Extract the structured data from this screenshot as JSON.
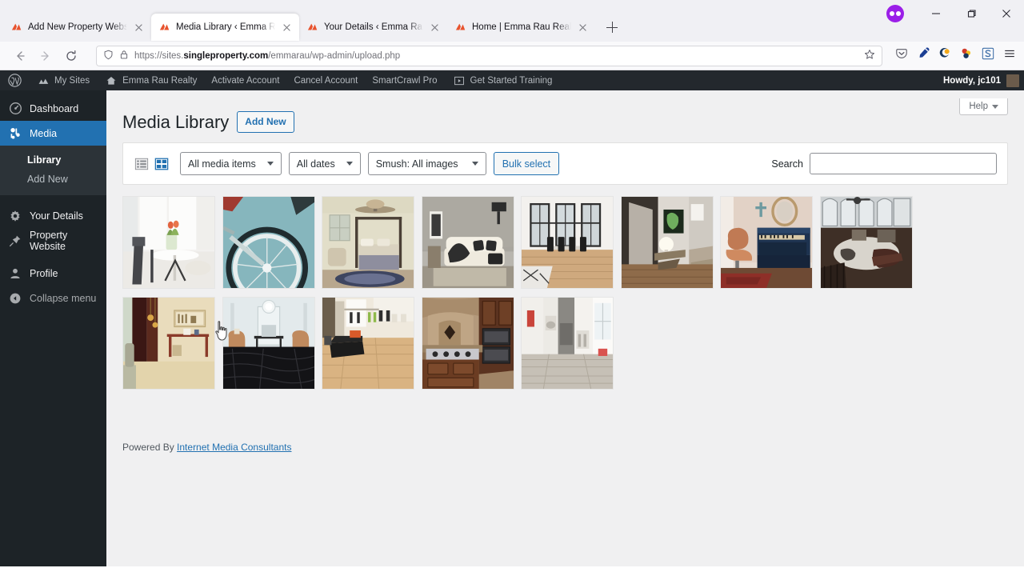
{
  "browser": {
    "tabs": [
      {
        "title": "Add New Property Website ‹ Em",
        "favicon": "singleproperty-logo-icon",
        "active": false
      },
      {
        "title": "Media Library ‹ Emma Rau Real",
        "favicon": "singleproperty-logo-icon",
        "active": true
      },
      {
        "title": "Your Details ‹ Emma Rau Realty",
        "favicon": "singleproperty-logo-icon",
        "active": false
      },
      {
        "title": "Home | Emma Rau Realty",
        "favicon": "singleproperty-logo-icon",
        "active": false
      }
    ],
    "new_tab_label": "+",
    "url_prefix": "https://sites.",
    "url_domain": "singleproperty.com",
    "url_path": "/emmarau/wp-admin/upload.php",
    "nav": {
      "back": "←",
      "forward": "→",
      "reload": "↻"
    },
    "toolbar_icons": [
      "pocket-icon",
      "eyedropper-icon",
      "smush-extension-icon",
      "colorzilla-icon",
      "s-extension-icon",
      "hamburger-menu-icon"
    ],
    "window_controls": {
      "minimize": "–",
      "maximize": "❐",
      "close": "✕"
    },
    "profile_badge": "firefox-account-avatar"
  },
  "adminbar": {
    "items": [
      {
        "label": "",
        "icon": "wordpress-logo-icon"
      },
      {
        "label": "My Sites",
        "icon": "multisite-icon"
      },
      {
        "label": "Emma Rau Realty",
        "icon": "home-icon"
      },
      {
        "label": "Activate Account",
        "icon": ""
      },
      {
        "label": "Cancel Account",
        "icon": ""
      },
      {
        "label": "SmartCrawl Pro",
        "icon": ""
      },
      {
        "label": "Get Started Training",
        "icon": "video-icon"
      }
    ],
    "howdy": "Howdy, jc101"
  },
  "sidebar": {
    "items": [
      {
        "label": "Dashboard",
        "icon": "dashboard-icon",
        "current": false
      },
      {
        "label": "Media",
        "icon": "media-icon",
        "current": true
      }
    ],
    "submenu": [
      {
        "label": "Library",
        "current": true
      },
      {
        "label": "Add New",
        "current": false
      }
    ],
    "items2": [
      {
        "label": "Your Details",
        "icon": "gear-icon"
      },
      {
        "label": "Property Website",
        "icon": "pin-icon"
      }
    ],
    "items3": [
      {
        "label": "Profile",
        "icon": "user-icon"
      },
      {
        "label": "Collapse menu",
        "icon": "collapse-icon"
      }
    ]
  },
  "page": {
    "help_tab": "Help",
    "title": "Media Library",
    "add_new_label": "Add New",
    "footer_prefix": "Powered By ",
    "footer_link": "Internet Media Consultants"
  },
  "filters": {
    "list_view_icon": "list-view-icon",
    "grid_view_icon": "grid-view-icon",
    "media_type": "All media items",
    "date": "All dates",
    "smush": "Smush: All images",
    "bulk_select": "Bulk select",
    "search_label": "Search",
    "search_value": "",
    "search_placeholder": ""
  },
  "media_items": [
    {
      "name": "dining-nook-tulips",
      "alt": "White dining nook with tulips"
    },
    {
      "name": "bicycle-wheel-teal",
      "alt": "Bicycle wheel on teal wall"
    },
    {
      "name": "canopy-bed-bedroom",
      "alt": "Bedroom with canopy bed and ceiling fan"
    },
    {
      "name": "grey-sofa-living-room",
      "alt": "Grey living room with sofa and throw"
    },
    {
      "name": "white-dining-room-windows",
      "alt": "White dining room with tall windows"
    },
    {
      "name": "modern-hallway-lamp",
      "alt": "Modern hallway with globe lamp and art"
    },
    {
      "name": "lounge-chair-piano",
      "alt": "Leather lounge chair beside blue piano"
    },
    {
      "name": "loft-overhead-view",
      "alt": "Overhead view of loft living area"
    },
    {
      "name": "entry-console-table",
      "alt": "Entryway with console table and pendant"
    },
    {
      "name": "black-floor-living-room",
      "alt": "Living room with black marble floor"
    },
    {
      "name": "open-plan-wood-floor",
      "alt": "Open plan room with light wood floor"
    },
    {
      "name": "wood-kitchen-range",
      "alt": "Traditional wood kitchen with range"
    },
    {
      "name": "grey-wood-hallway",
      "alt": "Grey wood floor hallway to dining"
    }
  ],
  "colors": {
    "wp_blue": "#2271b1",
    "admin_dark": "#1d2327",
    "adminbar": "#23282d",
    "content_bg": "#f0f0f1",
    "link": "#2271b1"
  }
}
